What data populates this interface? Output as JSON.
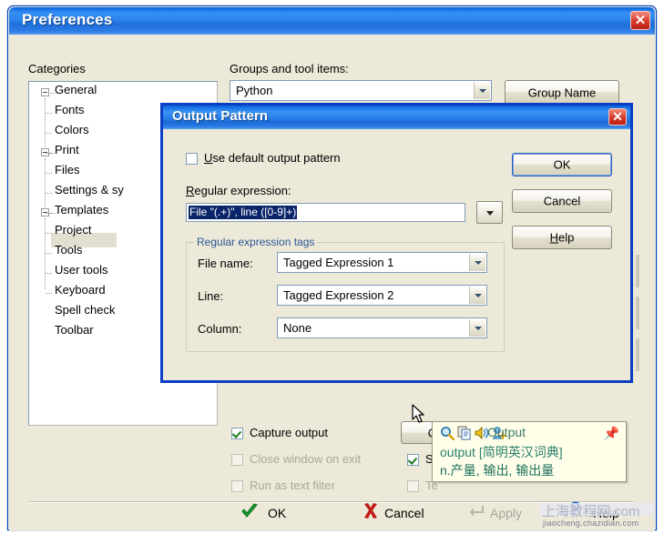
{
  "prefs": {
    "title": "Preferences",
    "close_icon": "close-icon",
    "categories_label": "Categories",
    "groups_label": "Groups and tool items:",
    "group_combo_value": "Python",
    "group_name_button": "Group Name",
    "tree": [
      {
        "label": "General",
        "level": 0,
        "expander": "minus"
      },
      {
        "label": "Fonts",
        "level": 1,
        "expander": "none"
      },
      {
        "label": "Colors",
        "level": 1,
        "expander": "none"
      },
      {
        "label": "Print",
        "level": 1,
        "expander": "none"
      },
      {
        "label": "Files",
        "level": 0,
        "expander": "minus"
      },
      {
        "label": "Settings & sy",
        "level": 1,
        "expander": "none"
      },
      {
        "label": "Templates",
        "level": 1,
        "expander": "none"
      },
      {
        "label": "Project",
        "level": 1,
        "expander": "none"
      },
      {
        "label": "Tools",
        "level": 0,
        "expander": "minus"
      },
      {
        "label": "User tools",
        "level": 1,
        "expander": "none",
        "selected": true
      },
      {
        "label": "Keyboard",
        "level": 1,
        "expander": "none"
      },
      {
        "label": "Spell check",
        "level": 1,
        "expander": "none"
      },
      {
        "label": "Toolbar",
        "level": 1,
        "expander": "none"
      }
    ],
    "options": {
      "capture_output": {
        "label": "Capture output",
        "checked": true,
        "enabled": true
      },
      "close_window_on_exit": {
        "label": "Close window on exit",
        "checked": false,
        "enabled": false
      },
      "run_as_text_filter": {
        "label": "Run as text filter",
        "checked": false,
        "enabled": false
      },
      "save_all": {
        "label": "Sa",
        "checked": true,
        "enabled": true
      },
      "text_opt": {
        "label": "Te",
        "checked": false,
        "enabled": false
      }
    },
    "output_pattern_button": "Output Pattern...",
    "footer": {
      "ok": "OK",
      "cancel": "Cancel",
      "apply": "Apply",
      "help": "Help"
    }
  },
  "output_pattern_dialog": {
    "title": "Output Pattern",
    "close_icon": "close-icon",
    "use_default": {
      "label_pre": "U",
      "label_post": "se default output pattern",
      "checked": false
    },
    "regex_label_pre": "R",
    "regex_label_post": "egular expression:",
    "regex_value": "File \"(.+)\", line ([0-9]+)",
    "dropdown_icon": "chevron-down-icon",
    "tags_group_title": "Regular expression tags",
    "tags": [
      {
        "label": "File name:",
        "value": "Tagged Expression 1"
      },
      {
        "label": "Line:",
        "value": "Tagged Expression 2"
      },
      {
        "label": "Column:",
        "value": "None"
      }
    ],
    "buttons": {
      "ok": "OK",
      "cancel": "Cancel",
      "help_pre": "H",
      "help_post": "elp"
    }
  },
  "dictionary_tooltip": {
    "headword": "Output",
    "entry": "output [简明英汉词典]",
    "definition": "n.产量, 输出, 输出量",
    "icons": [
      "search-icon",
      "copy-icon",
      "speaker-icon",
      "add-word-icon",
      "pin-icon"
    ]
  },
  "watermark": {
    "text": "jiaocheng.chazidian.com",
    "overlay": "上海教程网.com"
  },
  "colors": {
    "titlebar_blue": "#1b76e8",
    "dialog_border": "#0b3fc4",
    "window_face": "#ece9d8",
    "selection_blue": "#0a246a",
    "tooltip_bg": "#ffffe9",
    "check_green": "#1a7a20",
    "close_red": "#d8392b"
  }
}
